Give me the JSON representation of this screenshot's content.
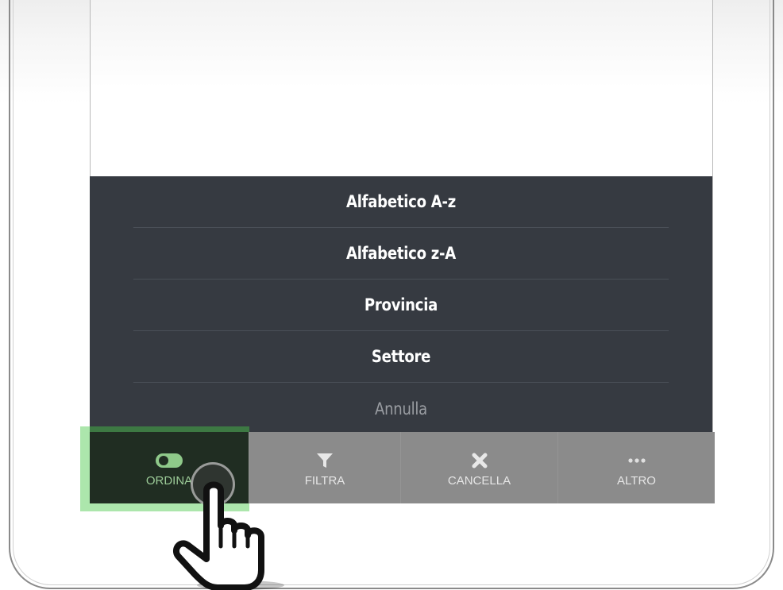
{
  "action_sheet": {
    "items": [
      {
        "label": "Alfabetico A-z"
      },
      {
        "label": "Alfabetico z-A"
      },
      {
        "label": "Provincia"
      },
      {
        "label": "Settore"
      }
    ],
    "cancel_label": "Annulla"
  },
  "tabbar": {
    "tabs": [
      {
        "label": "ORDINA",
        "icon": "toggle-icon",
        "active": true
      },
      {
        "label": "FILTRA",
        "icon": "filter-icon"
      },
      {
        "label": "CANCELLA",
        "icon": "close-icon"
      },
      {
        "label": "ALTRO",
        "icon": "more-dots-icon"
      }
    ]
  },
  "colors": {
    "sheet_bg": "#363a41",
    "tabbar_bg": "#8b8b8b",
    "active_tab_bg": "#202d22",
    "highlight": "#46c846"
  }
}
